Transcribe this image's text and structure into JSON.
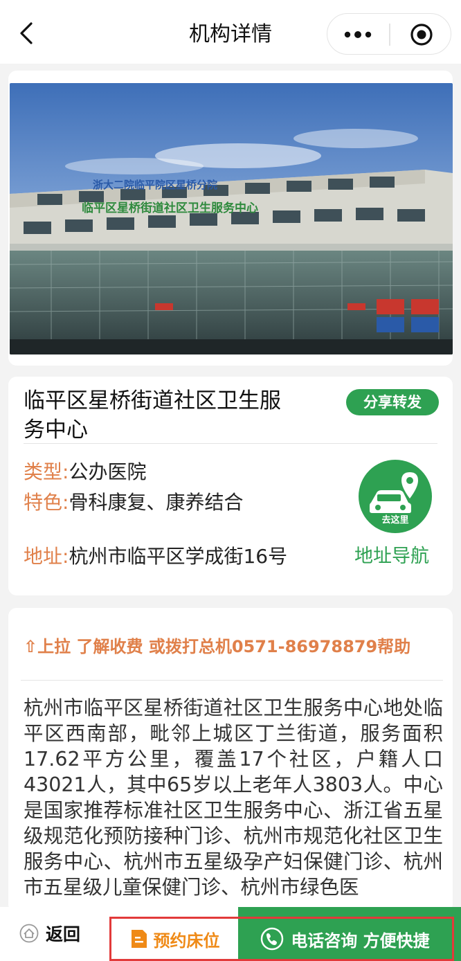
{
  "header": {
    "title": "机构详情"
  },
  "institution": {
    "name": "临平区星桥街道社区卫生服务中心",
    "share_label": "分享转发",
    "type_label": "类型:",
    "type_value": "公办医院",
    "feature_label": "特色:",
    "feature_value": "骨科康复、康养结合",
    "address_label": "地址:",
    "address_value": "杭州市临平区学成街16号",
    "goto_label": "去这里",
    "nav_label": "地址导航"
  },
  "banner": {
    "sign_top": "浙大二院临平院区星桥分院",
    "sign_main": "临平区星桥街道社区卫生服务中心",
    "dot_count": 6,
    "active_dot": 0
  },
  "description": {
    "tip": "⇧上拉 了解收费 或拨打总机0571-86978879帮助",
    "text": "杭州市临平区星桥街道社区卫生服务中心地处临平区西南部，毗邻上城区丁兰街道，服务面积17.62平方公里，覆盖17个社区，户籍人口43021人，其中65岁以上老年人3803人。中心是国家推荐标准社区卫生服务中心、浙江省五星级规范化预防接种门诊、杭州市规范化社区卫生服务中心、杭州市五星级孕产妇保健门诊、杭州市五星级儿童保健门诊、杭州市绿色医"
  },
  "bottom_bar": {
    "back_label": "返回",
    "reserve_label": "预约床位",
    "call_label": "电话咨询 方便快捷"
  },
  "colors": {
    "accent_green": "#2ea152",
    "accent_orange": "#e0804a",
    "highlight_red": "#e23a3a"
  }
}
